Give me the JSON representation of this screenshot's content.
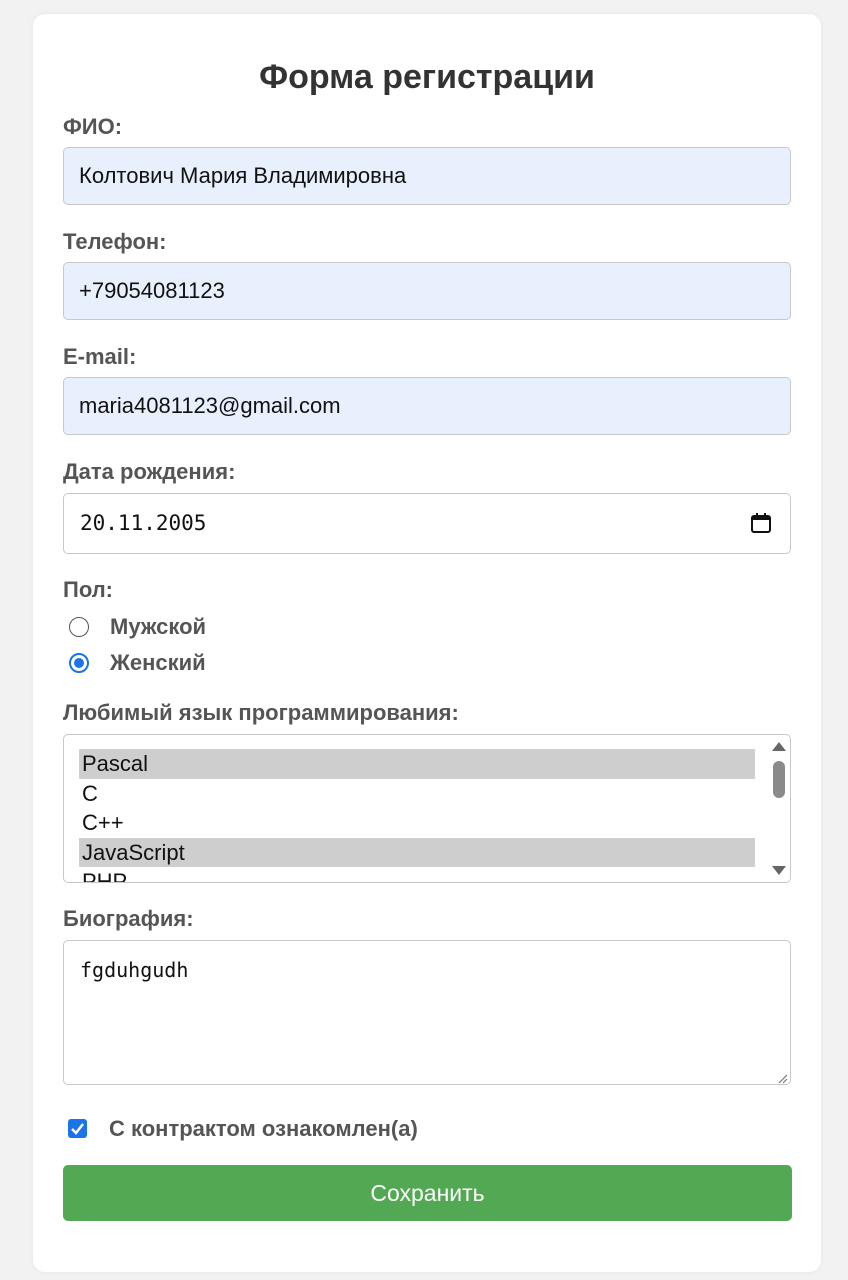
{
  "form": {
    "title": "Форма регистрации",
    "fio": {
      "label": "ФИО:",
      "value": "Колтович Мария Владимировна"
    },
    "phone": {
      "label": "Телефон:",
      "value": "+79054081123"
    },
    "email": {
      "label": "E-mail:",
      "value": "maria4081123@gmail.com"
    },
    "birthdate": {
      "label": "Дата рождения:",
      "value": "20.11.2005",
      "icon": "calendar-icon"
    },
    "gender": {
      "label": "Пол:",
      "options": [
        {
          "label": "Мужской",
          "checked": false
        },
        {
          "label": "Женский",
          "checked": true
        }
      ]
    },
    "languages": {
      "label": "Любимый язык программирования:",
      "options": [
        {
          "label": "Pascal",
          "selected": true
        },
        {
          "label": "C",
          "selected": false
        },
        {
          "label": "C++",
          "selected": false
        },
        {
          "label": "JavaScript",
          "selected": true
        },
        {
          "label": "PHP",
          "selected": false
        }
      ]
    },
    "bio": {
      "label": "Биография:",
      "value": "fgduhgudh"
    },
    "contract": {
      "label": "С контрактом ознакомлен(а)",
      "checked": true
    },
    "submit_label": "Сохранить"
  },
  "colors": {
    "accent": "#1a73e8",
    "submit": "#53a853",
    "autofill": "#e8f0fe",
    "selected_option": "#cecece"
  }
}
